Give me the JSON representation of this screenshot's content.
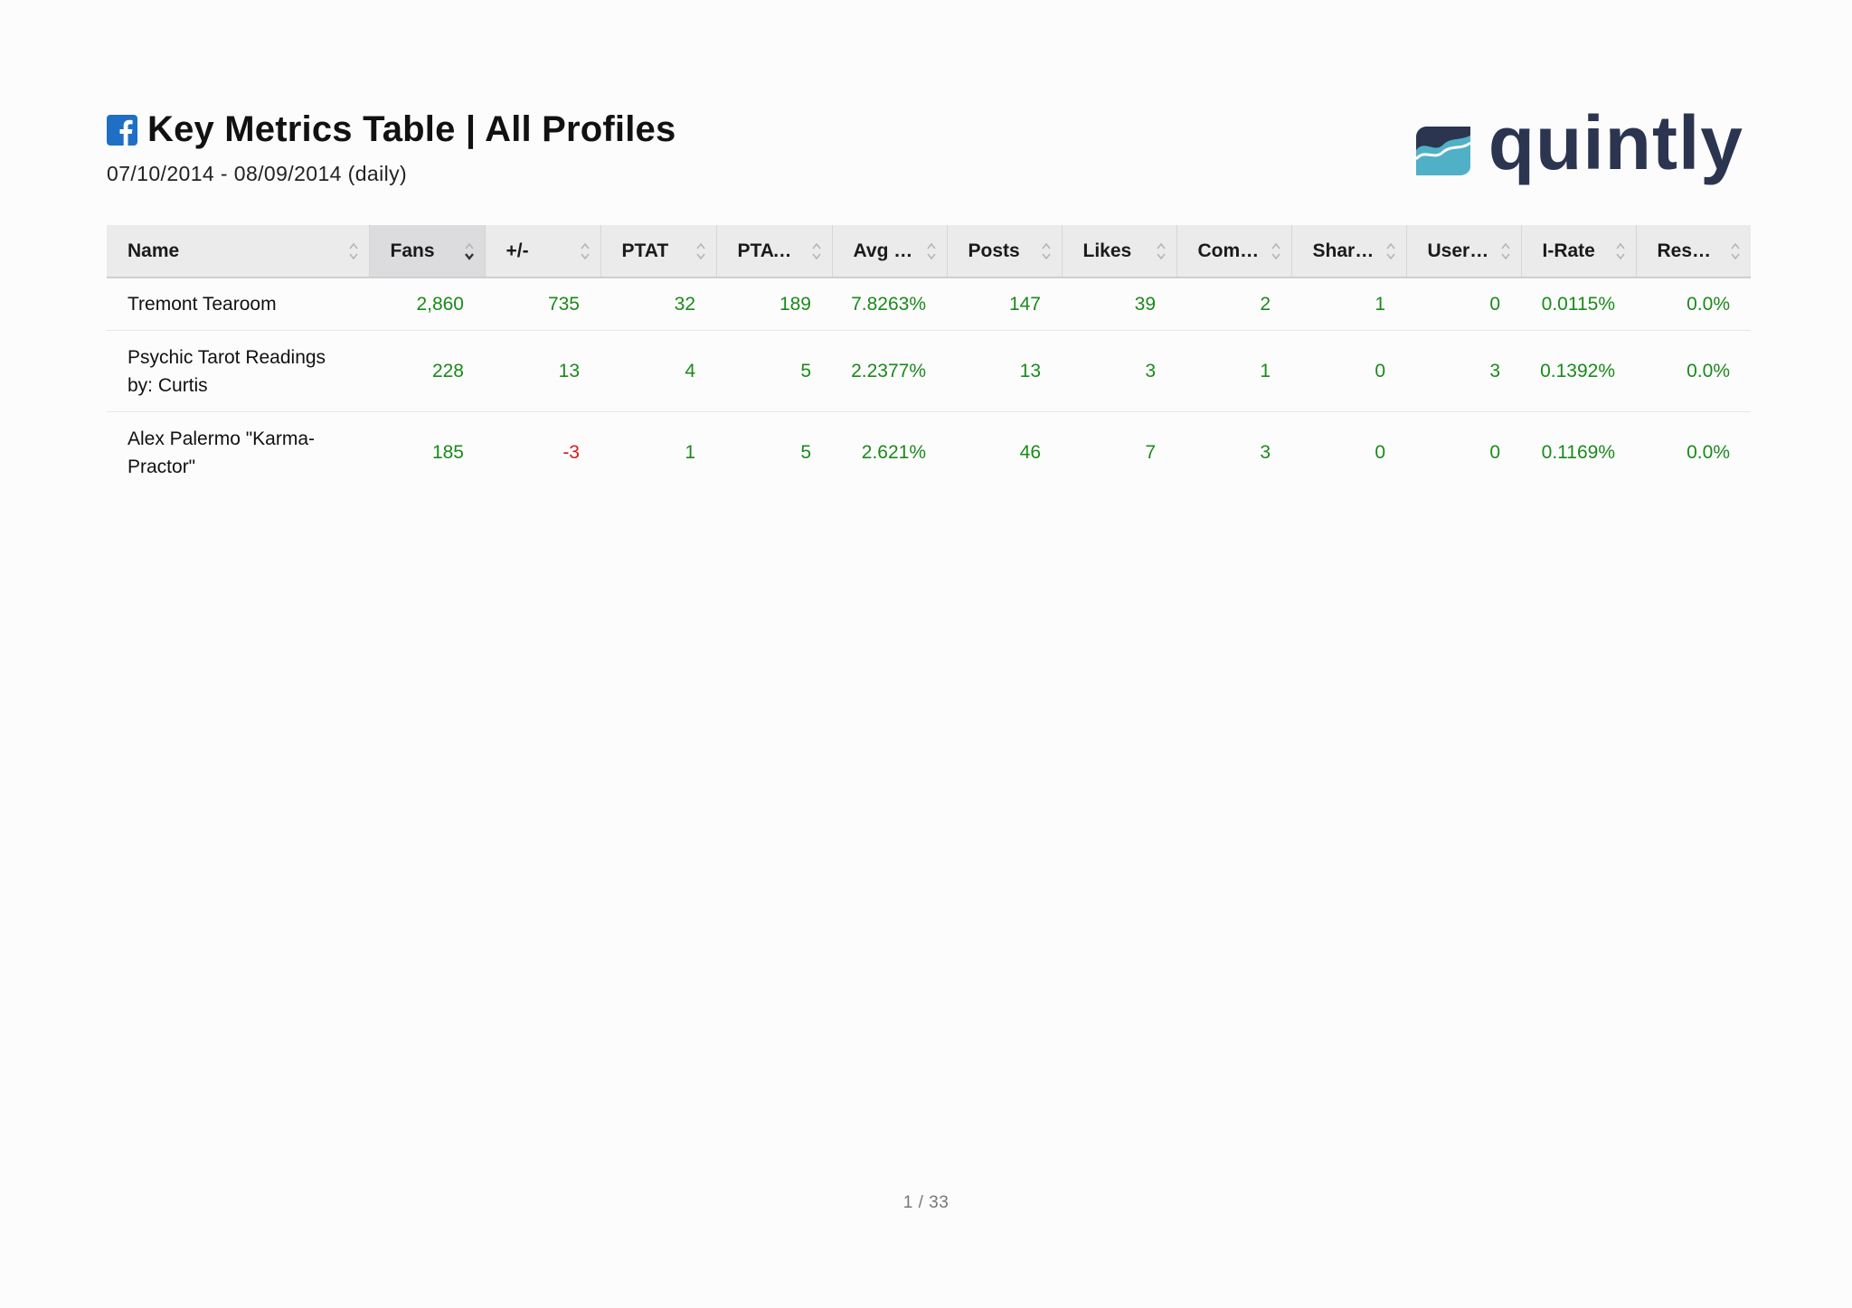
{
  "header": {
    "title": "Key Metrics Table | All Profiles",
    "date_range": "07/10/2014 - 08/09/2014 (daily)",
    "logo_text": "quintly",
    "title_icon": "facebook-icon"
  },
  "table": {
    "columns": [
      "Name",
      "Fans",
      "+/-",
      "PTAT",
      "PTAT ...",
      "Avg P...",
      "Posts",
      "Likes",
      "Comm...",
      "Shares",
      "User P...",
      "I-Rate",
      "Respo..."
    ],
    "sorted_column": "Fans",
    "rows": [
      [
        "Tremont Tearoom",
        "2,860",
        "735",
        "32",
        "189",
        "7.8263%",
        "147",
        "39",
        "2",
        "1",
        "0",
        "0.0115%",
        "0.0%"
      ],
      [
        "Psychic Tarot Readings by: Curtis",
        "228",
        "13",
        "4",
        "5",
        "2.2377%",
        "13",
        "3",
        "1",
        "0",
        "3",
        "0.1392%",
        "0.0%"
      ],
      [
        "Alex Palermo \"Karma-Practor\"",
        "185",
        "-3",
        "1",
        "5",
        "2.621%",
        "46",
        "7",
        "3",
        "0",
        "0",
        "0.1169%",
        "0.0%"
      ]
    ]
  },
  "footer": {
    "page_number": "1 / 33"
  },
  "colors": {
    "positive": "#1a8a1a",
    "negative": "#d91a1a",
    "header_bg": "#ebebec",
    "logo_dark": "#2b3550",
    "logo_teal": "#4fb0c6",
    "facebook_blue": "#1f6fc5"
  }
}
